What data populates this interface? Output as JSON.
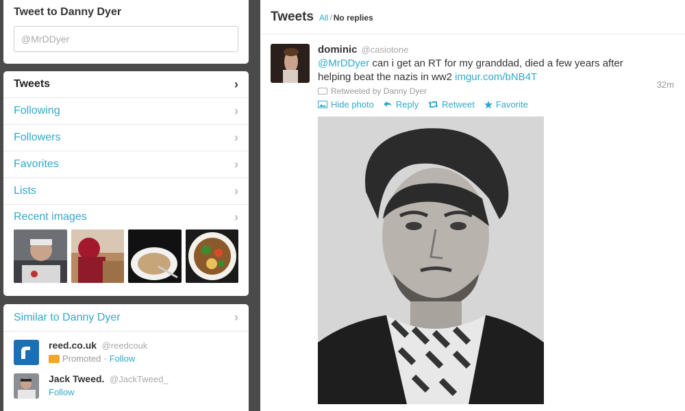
{
  "tweet_to": {
    "title": "Tweet to Danny Dyer",
    "placeholder": "@MrDDyer"
  },
  "nav": {
    "items": [
      {
        "label": "Tweets"
      },
      {
        "label": "Following"
      },
      {
        "label": "Followers"
      },
      {
        "label": "Favorites"
      },
      {
        "label": "Lists"
      }
    ],
    "recent_images_label": "Recent images",
    "chevron": "›"
  },
  "similar": {
    "title": "Similar to Danny Dyer",
    "suggestions": [
      {
        "name": "reed.co.uk",
        "handle": "@reedcouk",
        "promoted": "Promoted",
        "dot": "·",
        "follow": "Follow"
      },
      {
        "name": "Jack Tweed.",
        "handle": "@JackTweed_",
        "follow": "Follow"
      }
    ]
  },
  "main": {
    "title": "Tweets",
    "filter_all": "All",
    "filter_sep": "/",
    "filter_noreplies": "No replies"
  },
  "tweet": {
    "name": "dominic",
    "handle": "@casiotone",
    "time": "32m",
    "mention": "@MrDDyer",
    "text": " can i get an RT for my granddad, died a few years after helping beat the nazis in ww2 ",
    "link": "imgur.com/bNB4T",
    "retweeted_by": "Retweeted by Danny Dyer",
    "actions": {
      "hide_photo": "Hide photo",
      "reply": "Reply",
      "retweet": "Retweet",
      "favorite": "Favorite"
    }
  },
  "colors": {
    "link": "#2fa9c9",
    "background": "#4a4a4a"
  }
}
